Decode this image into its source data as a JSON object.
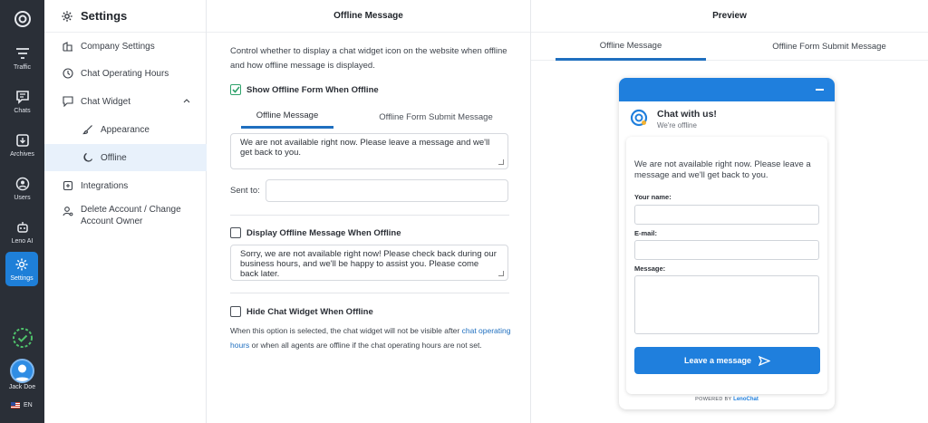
{
  "rail": {
    "items": [
      {
        "label": "Traffic",
        "icon": "filter-icon"
      },
      {
        "label": "Chats",
        "icon": "chat-bubble-icon"
      },
      {
        "label": "Archives",
        "icon": "archive-icon"
      },
      {
        "label": "Users",
        "icon": "users-icon"
      },
      {
        "label": "Leno AI",
        "icon": "robot-icon"
      },
      {
        "label": "Settings",
        "icon": "gear-icon"
      }
    ],
    "user_name": "Jack Doe",
    "language": "EN",
    "accent_color": "#1e7fd8"
  },
  "sidebar": {
    "title": "Settings",
    "items": [
      {
        "label": "Company Settings",
        "icon": "building-icon"
      },
      {
        "label": "Chat Operating Hours",
        "icon": "clock-icon"
      },
      {
        "label": "Chat Widget",
        "icon": "chat-widget-icon"
      },
      {
        "label": "Appearance",
        "icon": "brush-icon"
      },
      {
        "label": "Offline",
        "icon": "moon-icon"
      },
      {
        "label": "Integrations",
        "icon": "integration-icon"
      },
      {
        "label": "Delete Account / Change Account Owner",
        "icon": "user-gear-icon"
      }
    ]
  },
  "middle": {
    "title": "Offline Message",
    "description": "Control whether to display a chat widget icon on the website when offline and how offline message is displayed.",
    "show_form": {
      "label": "Show Offline Form When Offline",
      "checked": true
    },
    "tabs": [
      "Offline Message",
      "Offline Form Submit Message"
    ],
    "offline_message_text": "We are not available right now. Please leave a message and we'll get back to you.",
    "sent_to_label": "Sent to:",
    "sent_to_value": "",
    "display_offline": {
      "label": "Display Offline Message When Offline",
      "checked": false
    },
    "offline_message_2": "Sorry, we are not available right now! Please check back during our business hours, and we'll be happy to assist you. Please come back later.",
    "hide_widget": {
      "label": "Hide Chat Widget When Offline",
      "checked": false
    },
    "note_before": "When this option is selected, the chat widget will not be visible after ",
    "note_link": "chat operating hours",
    "note_after": " or when all agents are offline if the chat operating hours are not set."
  },
  "preview": {
    "title": "Preview",
    "tabs": [
      "Offline Message",
      "Offline Form Submit Message"
    ],
    "widget": {
      "title": "Chat with us!",
      "status": "We're offline",
      "message": "We are not available right now. Please leave a message and we'll get back to you.",
      "name_label": "Your name:",
      "email_label": "E-mail:",
      "message_label": "Message:",
      "button_label": "Leave a message",
      "powered_by": "POWERED BY",
      "brand": "LenoChat",
      "brand_color": "#1f7fdd"
    }
  }
}
